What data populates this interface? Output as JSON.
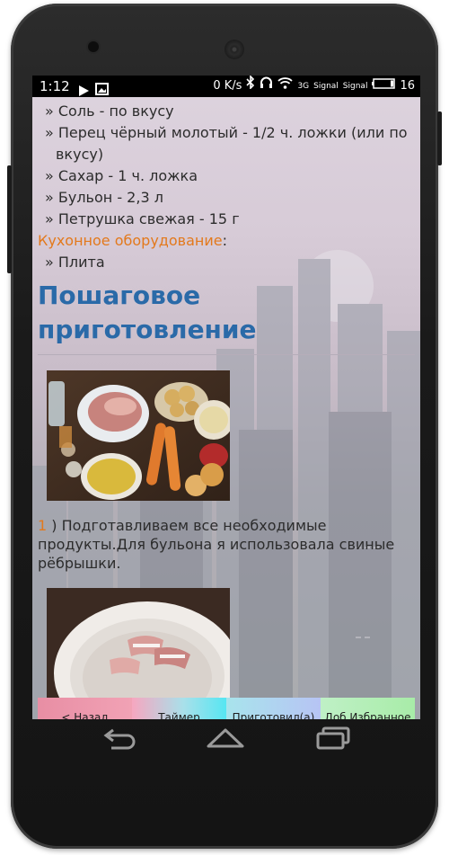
{
  "status_bar": {
    "time": "1:12",
    "net_speed": "0 K/s",
    "network_type": "3G",
    "signal1_label": "Signal",
    "signal2_label": "Signal",
    "battery": "16"
  },
  "ingredients": [
    "» Соль - по вкусу",
    "» Перец чёрный молотый - 1/2 ч. ложки (или по",
    "вкусу)",
    "» Сахар - 1 ч. ложка",
    "» Бульон - 2,3 л",
    "» Петрушка свежая - 15 г"
  ],
  "equipment": {
    "label": "Кухонное оборудование",
    "colon": ":",
    "items": [
      "» Плита"
    ]
  },
  "section_title_line1": "Пошаговое",
  "section_title_line2": "приготовление",
  "steps": [
    {
      "number": "1",
      "sep": " ) ",
      "text_line1": "Подготавливаем все необходимые",
      "text_line2": "продукты.Для бульона я использовала свиные",
      "text_line3": "рёбрышки."
    }
  ],
  "buttons": {
    "back": "< Назад",
    "timer": "Таймер",
    "cooked": "Приготовил(а)",
    "favorite": "Доб.Избранное"
  },
  "colors": {
    "heading": "#2a6aa8",
    "accent_orange": "#e3791c"
  },
  "icons": {
    "play": "play-icon",
    "screenshot": "image-icon",
    "bluetooth": "bluetooth-icon",
    "headset": "headset-icon",
    "wifi": "wifi-icon",
    "battery": "battery-icon",
    "nav_back": "back-arrow-icon",
    "nav_home": "home-icon",
    "nav_recent": "recent-apps-icon"
  }
}
